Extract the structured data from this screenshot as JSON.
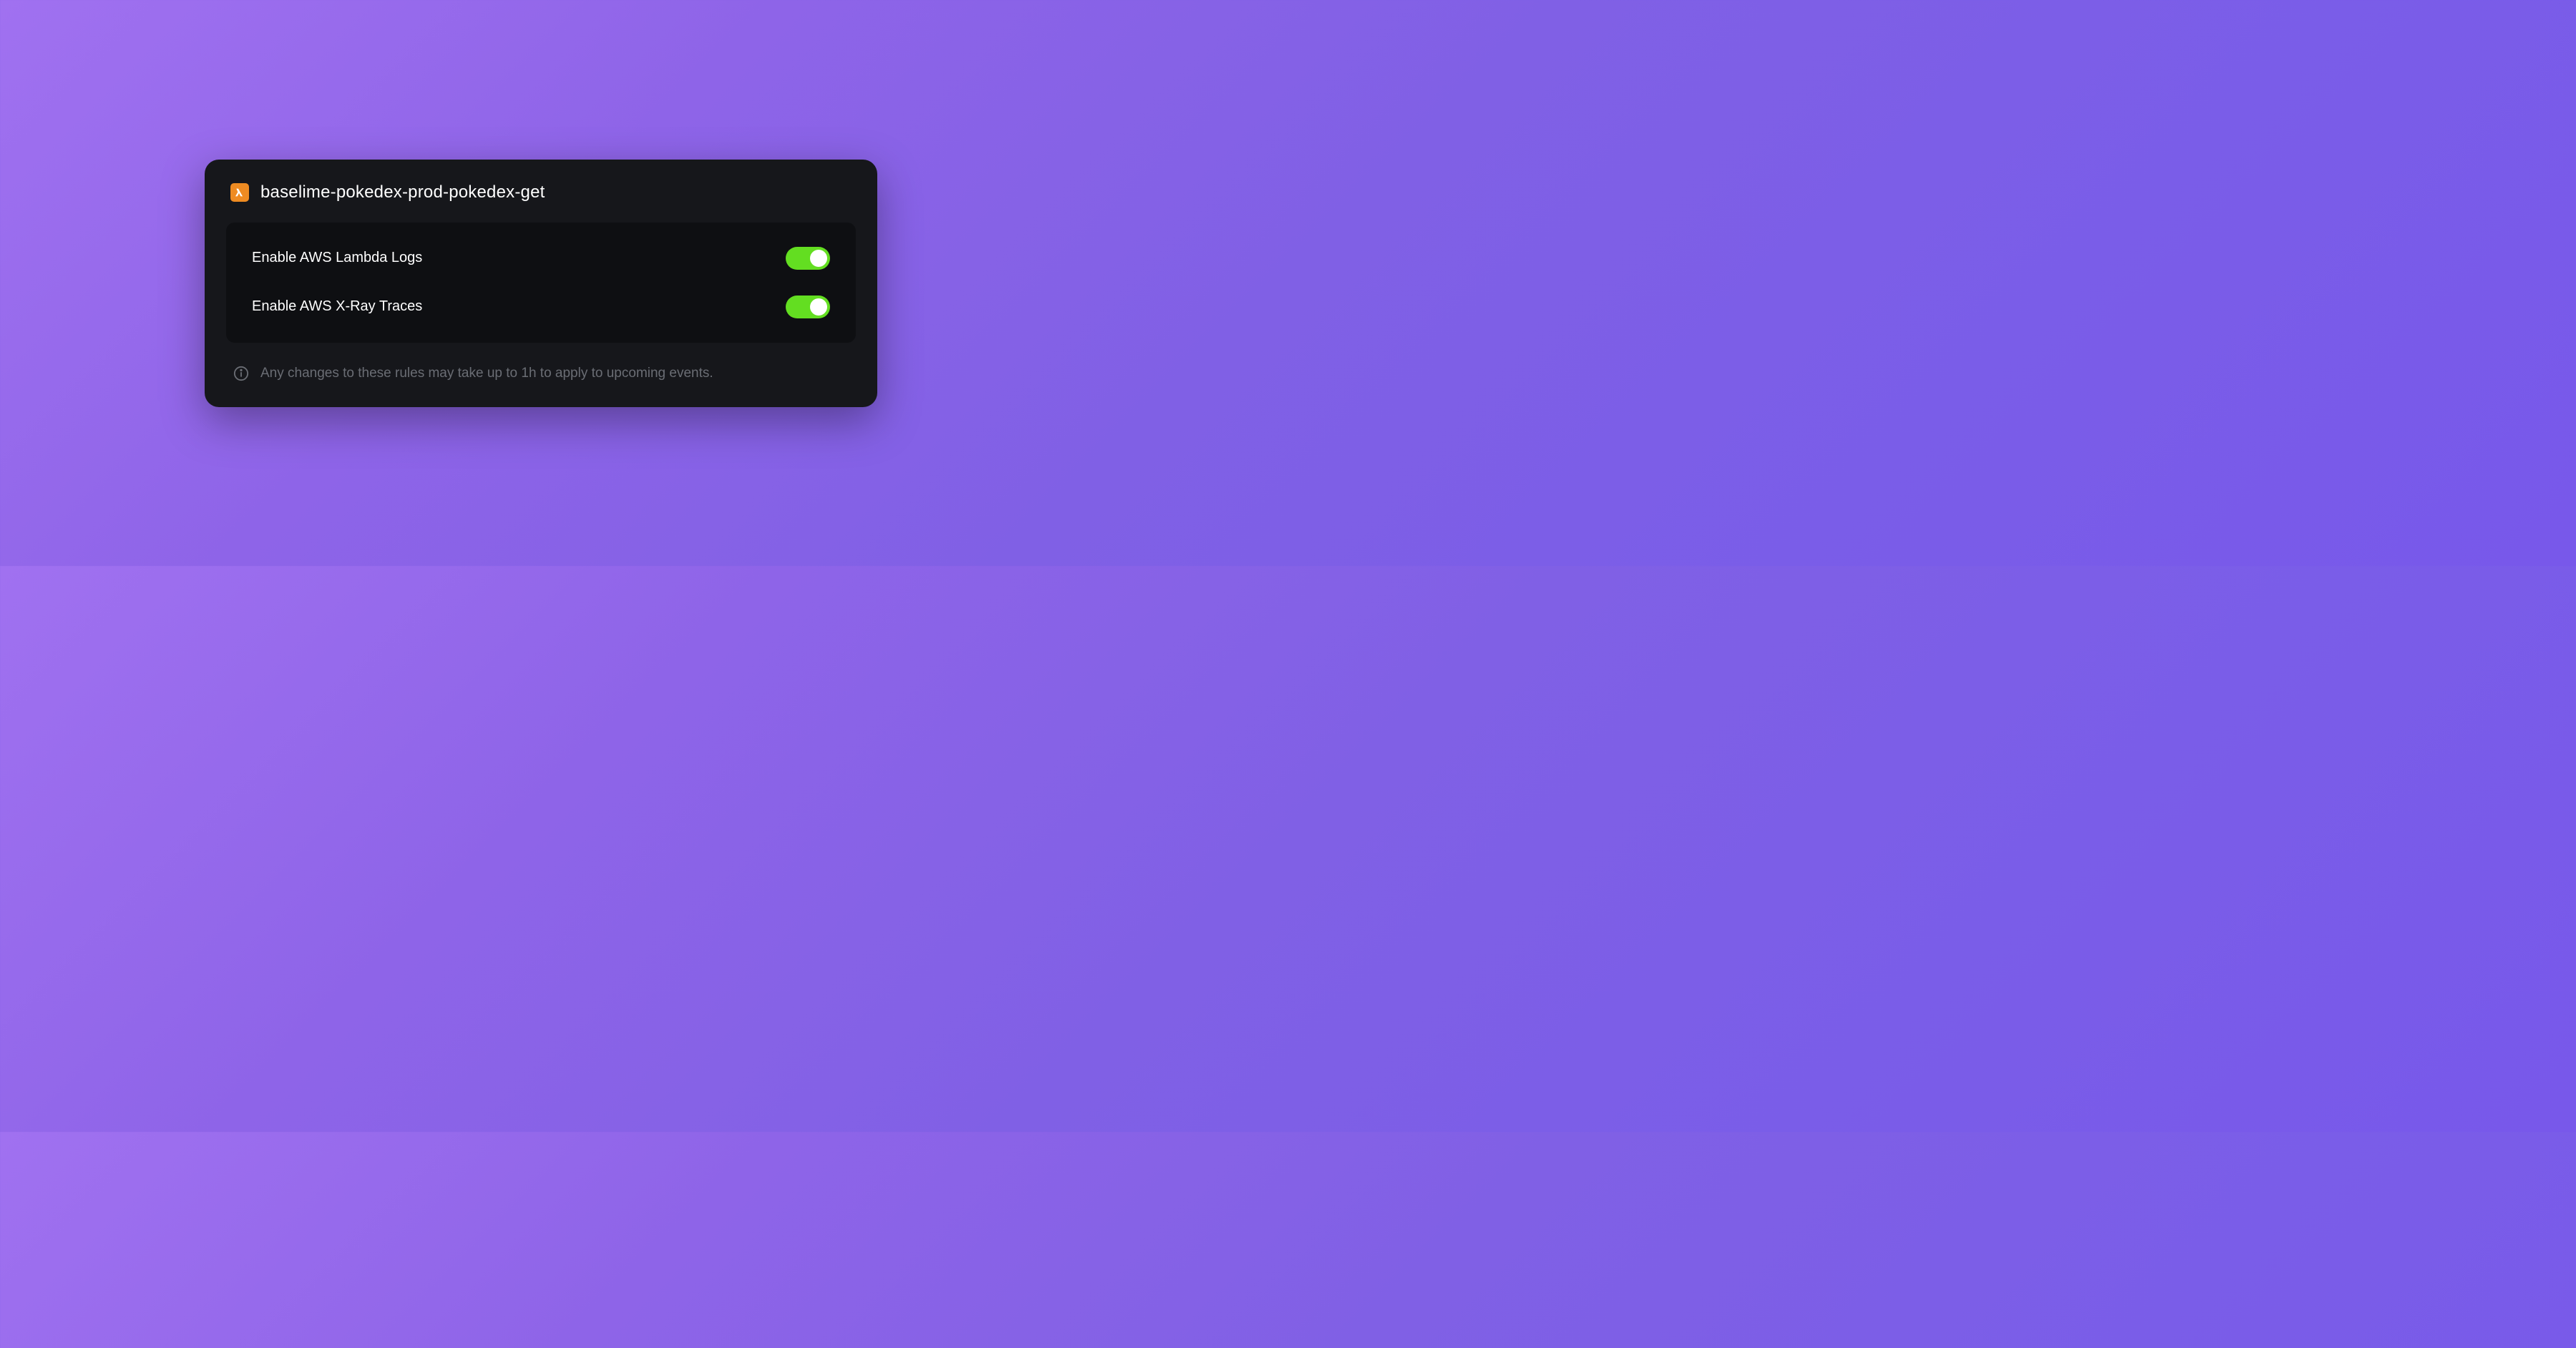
{
  "header": {
    "title": "baselime-pokedex-prod-pokedex-get",
    "icon": "lambda-icon"
  },
  "settings": [
    {
      "label": "Enable AWS Lambda Logs",
      "enabled": true
    },
    {
      "label": "Enable AWS X-Ray Traces",
      "enabled": true
    }
  ],
  "info": {
    "text": "Any changes to these rules may take up to 1h to apply to upcoming events."
  },
  "colors": {
    "toggle_on": "#63de21",
    "card_bg": "#16171b",
    "panel_bg": "#0e0f12",
    "lambda_icon": "#ee8b22"
  }
}
